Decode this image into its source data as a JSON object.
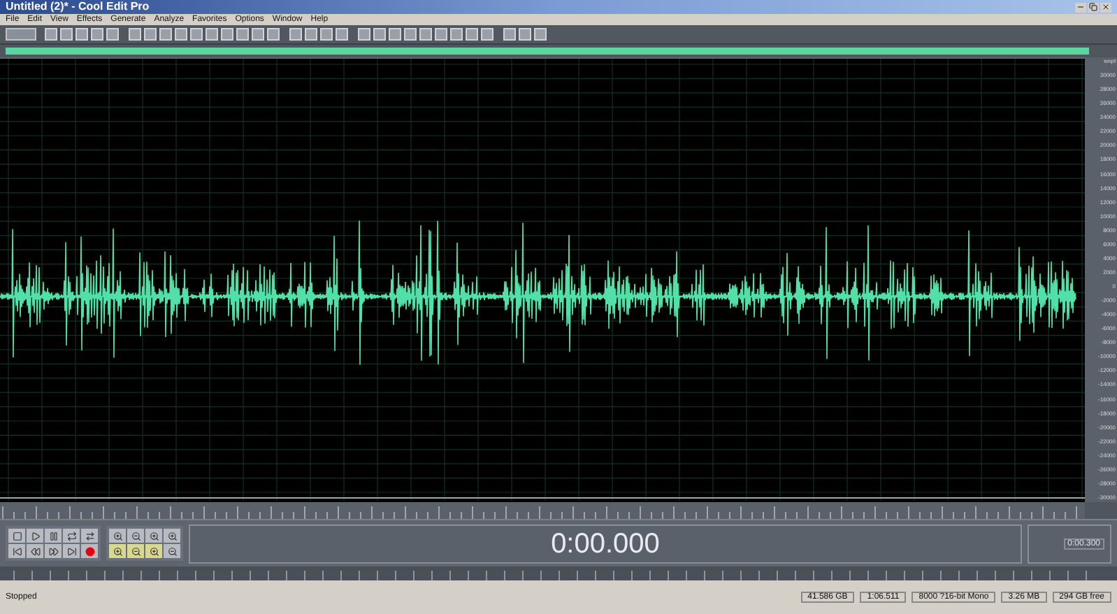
{
  "window": {
    "title": "Untitled (2)* - Cool Edit Pro"
  },
  "menu": [
    "File",
    "Edit",
    "View",
    "Effects",
    "Generate",
    "Analyze",
    "Favorites",
    "Options",
    "Window",
    "Help"
  ],
  "amplitude_ruler": [
    "smpl",
    "30000",
    "28000",
    "26000",
    "24000",
    "22000",
    "20000",
    "18000",
    "16000",
    "14000",
    "12000",
    "10000",
    "8000",
    "6000",
    "4000",
    "2000",
    "0",
    "-2000",
    "-4000",
    "-6000",
    "-8000",
    "-10000",
    "-12000",
    "-14000",
    "-16000",
    "-18000",
    "-20000",
    "-22000",
    "-24000",
    "-26000",
    "-28000",
    "-30000"
  ],
  "time_display": "0:00.000",
  "selection_panel": [
    "0:00.300"
  ],
  "status_bar": {
    "state": "Stopped",
    "fields": [
      "41.586 GB",
      "1:06.511",
      "8000 ?16-bit Mono",
      "3.26 MB",
      "294 GB free"
    ]
  }
}
